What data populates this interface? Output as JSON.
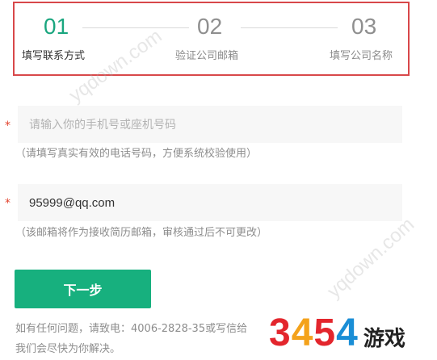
{
  "steps": [
    {
      "num": "01",
      "label": "填写联系方式"
    },
    {
      "num": "02",
      "label": "验证公司邮箱"
    },
    {
      "num": "03",
      "label": "填写公司名称"
    }
  ],
  "form": {
    "required_mark": "*",
    "phone": {
      "placeholder": "请输入你的手机号或座机号码",
      "value": "",
      "hint": "（请填写真实有效的电话号码，方便系统校验使用）"
    },
    "email": {
      "value": "95999@qq.com",
      "hint": "（该邮箱将作为接收简历邮箱，审核通过后不可更改）"
    },
    "next_label": "下一步"
  },
  "contact": {
    "line1": "如有任何问题，请致电：4006-2828-35或写信给",
    "line2": "我们会尽快为你解决。"
  },
  "watermark": {
    "text": "yqdown.com",
    "logo_digits": [
      "3",
      "4",
      "5",
      "4"
    ],
    "logo_text": "游戏"
  },
  "colors": {
    "accent": "#17b07e",
    "active_step": "#1aa67f",
    "highlight_border": "#d8484a",
    "required": "#e2452f"
  }
}
